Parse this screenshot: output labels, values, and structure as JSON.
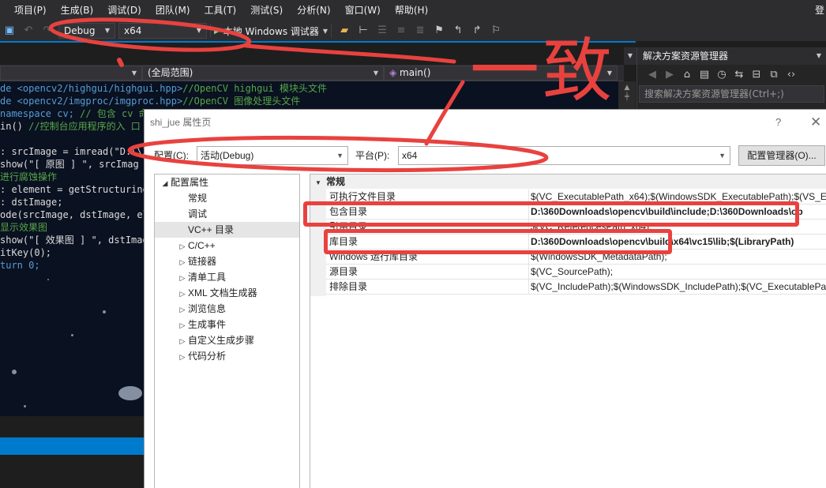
{
  "menu": {
    "items": [
      "项目(P)",
      "生成(B)",
      "调试(D)",
      "团队(M)",
      "工具(T)",
      "测试(S)",
      "分析(N)",
      "窗口(W)",
      "帮助(H)"
    ],
    "login": "登"
  },
  "toolbar": {
    "config": "Debug",
    "platform": "x64",
    "run_label": "本地 Windows 调试器"
  },
  "editor": {
    "nav_scope": "(全局范围)",
    "nav_function": "main()",
    "lines": [
      {
        "a": "de <opencv2/highgui/highgui.hpp>",
        "b": "//OpenCV highgui 模块头文件"
      },
      {
        "a": "de <opencv2/imgproc/imgproc.hpp>",
        "b": "//OpenCV 图像处理头文件"
      },
      {
        "a": "namespace cv;",
        "b": " // 包含 cv 命"
      },
      {
        "a": "in()",
        "b": " //控制台应用程序的入 口"
      },
      {
        "a": "",
        "b": ""
      },
      {
        "a": ": srcImage = imread(\"D:\\\\30",
        "b": ""
      },
      {
        "a": "show(\"[ 原图 ] \", srcImag",
        "b": ""
      },
      {
        "a": "",
        "b": "进行腐蚀操作"
      },
      {
        "a": ": element = getStructuringE",
        "b": ""
      },
      {
        "a": ": dstImage;",
        "b": ""
      },
      {
        "a": "ode(srcImage, dstImage, ele",
        "b": ""
      },
      {
        "a": "",
        "b": "显示效果图"
      },
      {
        "a": "show(\"[ 效果图 ] \", dstImag",
        "b": ""
      },
      {
        "a": "itKey(0);",
        "b": ""
      },
      {
        "a": "turn 0;",
        "b": ""
      }
    ]
  },
  "solution_explorer": {
    "title": "解决方案资源管理器",
    "search_placeholder": "搜索解决方案资源管理器(Ctrl+;)"
  },
  "dialog": {
    "title": "shi_jue 属性页",
    "help": "?",
    "close": "✕",
    "config_label": "配置(C):",
    "config_value": "活动(Debug)",
    "platform_label": "平台(P):",
    "platform_value": "x64",
    "config_manager": "配置管理器(O)...",
    "tree": [
      {
        "label": "配置属性",
        "level": 0,
        "twisty": "◢"
      },
      {
        "label": "常规",
        "level": 1,
        "twisty": ""
      },
      {
        "label": "调试",
        "level": 1,
        "twisty": ""
      },
      {
        "label": "VC++ 目录",
        "level": 1,
        "twisty": "",
        "selected": true
      },
      {
        "label": "C/C++",
        "level": 1,
        "twisty": "▷"
      },
      {
        "label": "链接器",
        "level": 1,
        "twisty": "▷"
      },
      {
        "label": "清单工具",
        "level": 1,
        "twisty": "▷"
      },
      {
        "label": "XML 文档生成器",
        "level": 1,
        "twisty": "▷"
      },
      {
        "label": "浏览信息",
        "level": 1,
        "twisty": "▷"
      },
      {
        "label": "生成事件",
        "level": 1,
        "twisty": "▷"
      },
      {
        "label": "自定义生成步骤",
        "level": 1,
        "twisty": "▷"
      },
      {
        "label": "代码分析",
        "level": 1,
        "twisty": "▷"
      }
    ],
    "category": "常规",
    "rows": [
      {
        "name": "可执行文件目录",
        "value": "$(VC_ExecutablePath_x64);$(WindowsSDK_ExecutablePath);$(VS_E",
        "bold": false
      },
      {
        "name": "包含目录",
        "value": "D:\\360Downloads\\opencv\\build\\include;D:\\360Downloads\\op",
        "bold": true
      },
      {
        "name": "引用目录",
        "value": "$(VC_ReferencesPath_x64);",
        "bold": false
      },
      {
        "name": "库目录",
        "value": "D:\\360Downloads\\opencv\\build\\x64\\vc15\\lib;$(LibraryPath)",
        "bold": true
      },
      {
        "name": "Windows 运行库目录",
        "value": "$(WindowsSDK_MetadataPath);",
        "bold": false
      },
      {
        "name": "源目录",
        "value": "$(VC_SourcePath);",
        "bold": false
      },
      {
        "name": "排除目录",
        "value": "$(VC_IncludePath);$(WindowsSDK_IncludePath);$(VC_ExecutablePa",
        "bold": false
      }
    ]
  },
  "annotation": {
    "text": "一致",
    "color": "#e8423f"
  }
}
